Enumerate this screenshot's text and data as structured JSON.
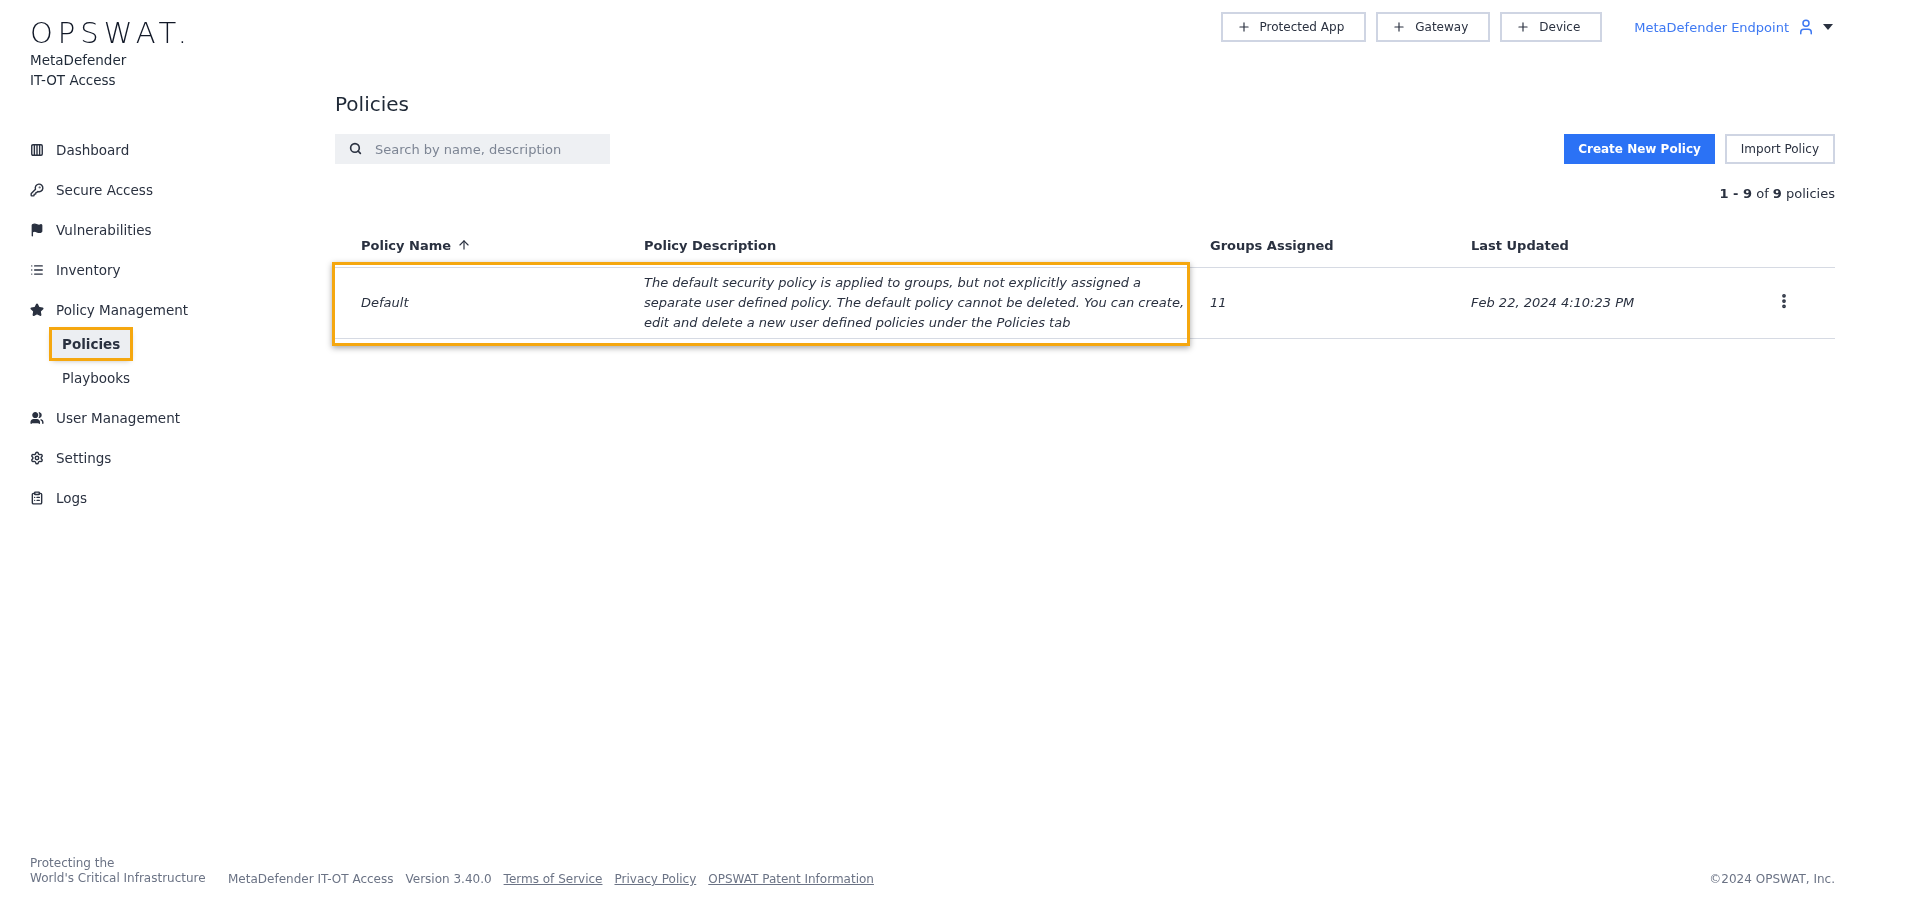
{
  "brand": {
    "logo": "OPSWAT.",
    "product_lines": [
      "MetaDefender",
      "IT-OT Access"
    ]
  },
  "sidebar": {
    "items": [
      {
        "label": "Dashboard",
        "selected": false
      },
      {
        "label": "Secure Access",
        "selected": false
      },
      {
        "label": "Vulnerabilities",
        "selected": false
      },
      {
        "label": "Inventory",
        "selected": false
      },
      {
        "label": "Policy Management",
        "selected": false,
        "children": [
          {
            "label": "Policies",
            "selected": true,
            "highlighted": true
          },
          {
            "label": "Playbooks",
            "selected": false,
            "highlighted": false
          }
        ]
      },
      {
        "label": "User Management",
        "selected": false
      },
      {
        "label": "Settings",
        "selected": false
      },
      {
        "label": "Logs",
        "selected": false
      }
    ]
  },
  "top_bar": {
    "add_buttons": [
      {
        "label": "Protected App"
      },
      {
        "label": "Gateway"
      },
      {
        "label": "Device"
      }
    ],
    "account": "MetaDefender Endpoint"
  },
  "page": {
    "title": "Policies",
    "search": {
      "placeholder": "Search by name, description"
    },
    "buttons": [
      {
        "kind": "primary",
        "label": "Create New Policy"
      },
      {
        "kind": "secondary",
        "label": "Import Policy"
      }
    ],
    "count": "**1 - 9** of **9** policies"
  },
  "table": {
    "columns": [
      {
        "label": "Policy Name",
        "sorted": true
      },
      {
        "label": "Policy Description",
        "sorted": false
      },
      {
        "label": "Groups Assigned",
        "sorted": false
      },
      {
        "label": "Last Updated",
        "sorted": false
      }
    ],
    "rows": [
      {
        "name": "Default",
        "description": "The default security policy is applied to groups, but not explicitly assigned a separate user defined policy. The default policy cannot be deleted. You can create, edit and delete a new user defined policies under the Policies tab",
        "groups": "11",
        "updated": "Feb 22, 2024 4:10:23 PM",
        "highlighted": true
      }
    ]
  },
  "footer": {
    "tagline": [
      "Protecting the",
      "World's Critical Infrastructure"
    ],
    "product": "MetaDefender IT-OT Access",
    "version": "Version 3.40.0",
    "links": [
      "Terms of Service",
      "Privacy Policy",
      "OPSWAT Patent Information"
    ],
    "copyright": "©2024 OPSWAT, Inc."
  }
}
